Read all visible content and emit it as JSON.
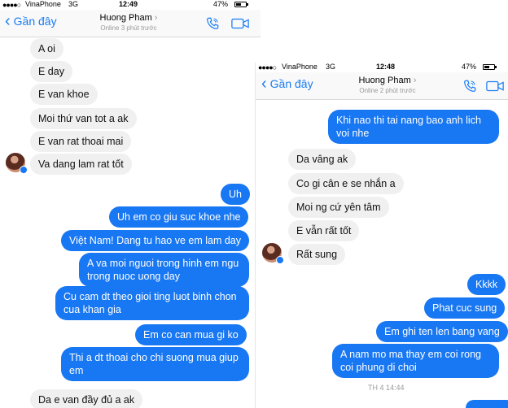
{
  "left": {
    "status": {
      "carrier": "VinaPhone",
      "network": "3G",
      "time": "12:49",
      "battery": "47%"
    },
    "nav": {
      "back_label": "Gần đây",
      "contact_name": "Huong Pham",
      "contact_sub": "Online 3 phút trước"
    },
    "messages": [
      {
        "dir": "in",
        "text": "A oi"
      },
      {
        "dir": "in",
        "text": "E day"
      },
      {
        "dir": "in",
        "text": "E van khoe"
      },
      {
        "dir": "in",
        "text": "Moi thứ van tot a ak"
      },
      {
        "dir": "in",
        "text": "E van rat thoai mai"
      },
      {
        "dir": "in",
        "text": "Va dang lam rat tốt"
      },
      {
        "dir": "out",
        "text": "Uh"
      },
      {
        "dir": "out",
        "text": "Uh em co giu suc khoe nhe"
      },
      {
        "dir": "out",
        "text": "Việt Nam! Dang tu hao ve em lam day"
      },
      {
        "dir": "out",
        "text": "A va moi nguoi trong hinh em ngu trong nuoc uong day"
      },
      {
        "dir": "out",
        "text": "Cu cam dt theo gioi ting luot binh chon cua khan gia"
      },
      {
        "dir": "out",
        "text": "Em co can mua gi ko"
      },
      {
        "dir": "out",
        "text": "Thi a dt thoai cho chi suong mua giup em"
      },
      {
        "dir": "in",
        "text": "Da e van đầy đủ a ak"
      }
    ]
  },
  "right": {
    "status": {
      "carrier": "VinaPhone",
      "network": "3G",
      "time": "12:48",
      "battery": "47%"
    },
    "nav": {
      "back_label": "Gần đây",
      "contact_name": "Huong Pham",
      "contact_sub": "Online 2 phút trước"
    },
    "messages": [
      {
        "dir": "out",
        "text": "Khi nao thi tai nang bao anh lich voi nhe"
      },
      {
        "dir": "in",
        "text": "Da vâng ak"
      },
      {
        "dir": "in",
        "text": "Co gi cân e se nhắn a"
      },
      {
        "dir": "in",
        "text": "Moi ng cứ yên tâm"
      },
      {
        "dir": "in",
        "text": "E vẫn rất tốt"
      },
      {
        "dir": "in",
        "text": "Rất sung"
      },
      {
        "dir": "out",
        "text": "Kkkk"
      },
      {
        "dir": "out",
        "text": "Phat cuc sung"
      },
      {
        "dir": "out",
        "text": "Em ghi ten len bang vang"
      },
      {
        "dir": "out",
        "text": "A nam mo ma thay em coi rong coi phung di choi"
      }
    ],
    "timestamp": "TH 4 14:44"
  },
  "colors": {
    "accent": "#1877f2",
    "incoming_bg": "#f0f0f0",
    "link_blue": "#1a7cf4"
  }
}
